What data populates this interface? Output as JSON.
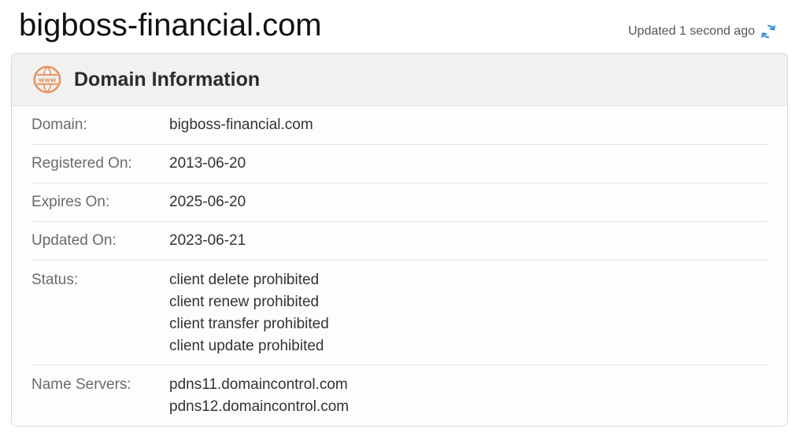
{
  "header": {
    "domain": "bigboss-financial.com",
    "updated_text": "Updated 1 second ago",
    "refresh_icon": "refresh-icon"
  },
  "card": {
    "icon": "www-icon",
    "title": "Domain Information",
    "accent_color": "#e8925a",
    "rows": {
      "domain": {
        "label": "Domain:",
        "value": "bigboss-financial.com"
      },
      "registered": {
        "label": "Registered On:",
        "value": "2013-06-20"
      },
      "expires": {
        "label": "Expires On:",
        "value": "2025-06-20"
      },
      "updated": {
        "label": "Updated On:",
        "value": "2023-06-21"
      },
      "status": {
        "label": "Status:",
        "values": [
          "client delete prohibited",
          "client renew prohibited",
          "client transfer prohibited",
          "client update prohibited"
        ]
      },
      "name_servers": {
        "label": "Name Servers:",
        "values": [
          "pdns11.domaincontrol.com",
          "pdns12.domaincontrol.com"
        ]
      }
    }
  },
  "colors": {
    "refresh": "#3b8fd9",
    "icon_orange": "#e8925a"
  }
}
